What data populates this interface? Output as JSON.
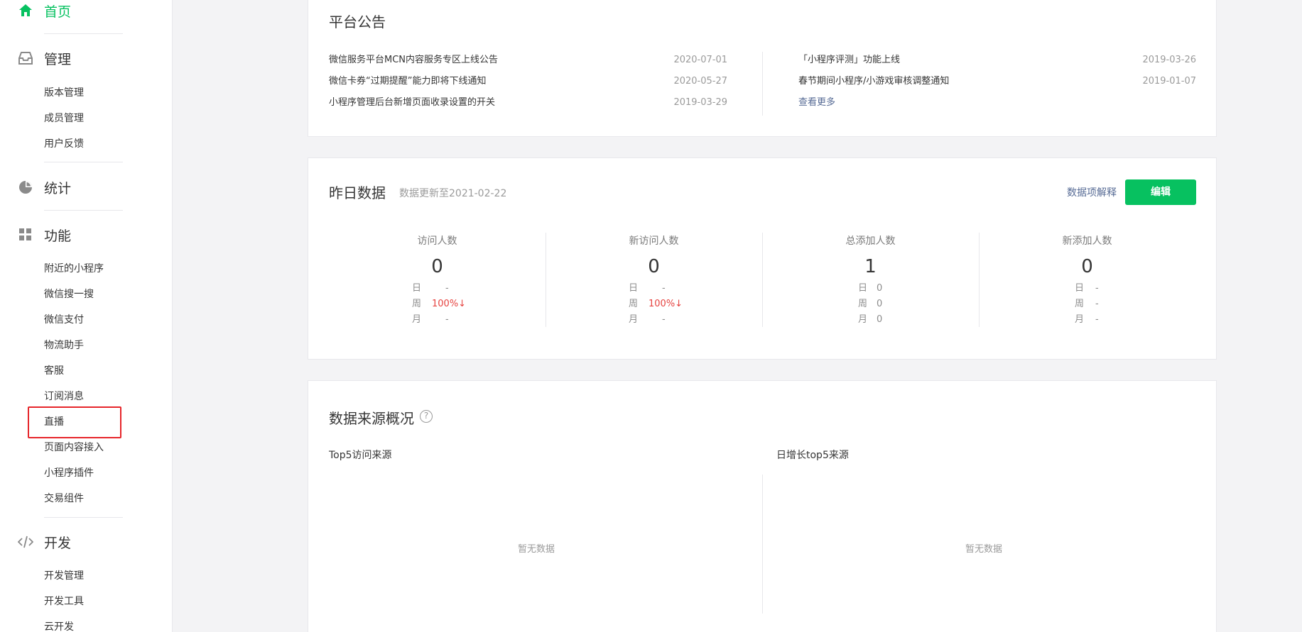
{
  "sidebar": {
    "home": {
      "label": "首页",
      "icon": "home-icon"
    },
    "manage": {
      "label": "管理",
      "icon": "inbox-icon",
      "items": [
        "版本管理",
        "成员管理",
        "用户反馈"
      ]
    },
    "stats": {
      "label": "统计",
      "icon": "pie-chart-icon"
    },
    "features": {
      "label": "功能",
      "icon": "grid-icon",
      "items": [
        "附近的小程序",
        "微信搜一搜",
        "微信支付",
        "物流助手",
        "客服",
        "订阅消息",
        "直播",
        "页面内容接入",
        "小程序插件",
        "交易组件"
      ]
    },
    "dev": {
      "label": "开发",
      "icon": "code-icon",
      "items": [
        "开发管理",
        "开发工具",
        "云开发"
      ]
    }
  },
  "announcements": {
    "title": "平台公告",
    "left": [
      {
        "text": "微信服务平台MCN内容服务专区上线公告",
        "date": "2020-07-01"
      },
      {
        "text": "微信卡券“过期提醒”能力即将下线通知",
        "date": "2020-05-27"
      },
      {
        "text": "小程序管理后台新增页面收录设置的开关",
        "date": "2019-03-29"
      }
    ],
    "right": [
      {
        "text": "「小程序评测」功能上线",
        "date": "2019-03-26"
      },
      {
        "text": "春节期间小程序/小游戏审核调整通知",
        "date": "2019-01-07"
      }
    ],
    "more": "查看更多"
  },
  "yesterday": {
    "title": "昨日数据",
    "updated": "数据更新至2021-02-22",
    "explain": "数据项解释",
    "edit": "编辑",
    "metrics": [
      {
        "label": "访问人数",
        "value": "0",
        "day_k": "日",
        "day": "-",
        "week_k": "周",
        "week": "100%↓",
        "month_k": "月",
        "month": "-"
      },
      {
        "label": "新访问人数",
        "value": "0",
        "day_k": "日",
        "day": "-",
        "week_k": "周",
        "week": "100%↓",
        "month_k": "月",
        "month": "-"
      },
      {
        "label": "总添加人数",
        "value": "1",
        "day_k": "日",
        "day": "0",
        "week_k": "周",
        "week": "0",
        "month_k": "月",
        "month": "0"
      },
      {
        "label": "新添加人数",
        "value": "0",
        "day_k": "日",
        "day": "-",
        "week_k": "周",
        "week": "-",
        "month_k": "月",
        "month": "-"
      }
    ],
    "colors": {
      "accent": "#07c160",
      "decline": "#e64340"
    }
  },
  "sources": {
    "title": "数据来源概况",
    "help": "?",
    "left_label": "Top5访问来源",
    "right_label": "日增长top5来源",
    "empty": "暂无数据"
  }
}
